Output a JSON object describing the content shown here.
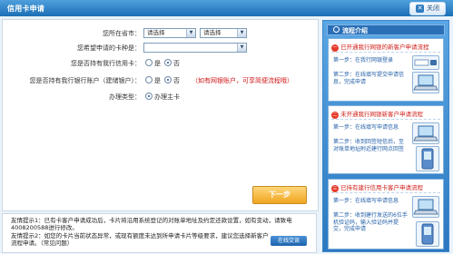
{
  "window": {
    "title": "信用卡申请",
    "close_label": "关闭"
  },
  "form": {
    "region": {
      "label": "您所在省市：",
      "province": "请选择",
      "city": "请选择"
    },
    "card_type": {
      "label": "您希望申请的卡种是：",
      "value": ""
    },
    "has_card": {
      "label": "您是否持有我行信用卡：",
      "yes": "是",
      "no": "否",
      "selected": "no"
    },
    "has_account": {
      "label": "您是否持有我行银行账户（建储银户）：",
      "yes": "是",
      "no": "否",
      "selected": "no",
      "note": "（如有网银账户，可享简便流程哦）"
    },
    "apply_type": {
      "label": "办理类型：",
      "option": "办理主卡",
      "selected": true
    },
    "next_label": "下一步"
  },
  "tips": {
    "tip1": "友情提示1：已有卡客户申请成功后，卡片将沿用系统登记的对账单地址及约定还款设置，如有变动，请致电4008200588进行修改。",
    "tip2": "友情提示2：如您的卡片当前状态异常，或现有额度未达到所申请卡片等级要求，建议您选择新客户流程申请。（常见问题）",
    "chat_label": "在线交谈"
  },
  "sidebar": {
    "title": "流程介绍",
    "panels": [
      {
        "num": "一",
        "title": "已开通我行网银的新客户申请流程",
        "steps": [
          {
            "label": "第一步：",
            "text": "在我行网银登录"
          },
          {
            "label": "第二步：",
            "text": "在线填写提交申请信息，完成申请"
          }
        ]
      },
      {
        "num": "二",
        "title": "未开通我行网银新客户申请流程",
        "steps": [
          {
            "label": "第一步：",
            "text": "在线填写申请信息"
          },
          {
            "label": "第二步：",
            "text": "收到回签短信后，至对账单地址附近建行网点回签"
          }
        ]
      },
      {
        "num": "三",
        "title": "已持有建行信用卡客户申请流程",
        "steps": [
          {
            "label": "第一步：",
            "text": "在线填写申请信息"
          },
          {
            "label": "第二步：",
            "text": "收到建行发送的6位手机验证码，输入验证码并提交，完成申请"
          }
        ]
      }
    ]
  },
  "colors": {
    "titlebar": "#2b7fca",
    "sidebar": "#3d8fd6",
    "accent_red": "#d11a1a",
    "button_orange": "#f0a51f"
  }
}
